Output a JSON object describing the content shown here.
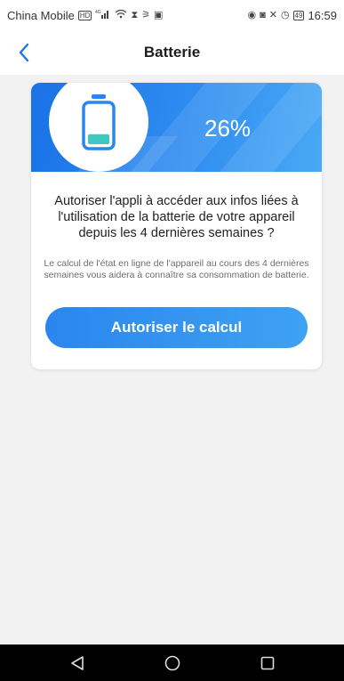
{
  "status_bar": {
    "carrier": "China Mobile",
    "signal_label": "4G",
    "battery_level": "49",
    "time": "16:59"
  },
  "header": {
    "title": "Batterie",
    "back_icon": "chevron-left-icon"
  },
  "battery_card": {
    "percent": "26%",
    "battery_fill_fraction": 0.26,
    "question": "Autoriser l'appli à accéder aux infos liées à l'utilisation de la batterie de votre appareil depuis les 4 dernières semaines ?",
    "explanation": "Le calcul de l'état en ligne de l'appareil au cours des 4 dernières semaines vous aidera à connaître sa consommation de batterie.",
    "button_label": "Autoriser le calcul",
    "accent_color": "#2f8df0"
  },
  "system_nav": {
    "icons": [
      "back-triangle-icon",
      "home-circle-icon",
      "recents-square-icon"
    ]
  }
}
